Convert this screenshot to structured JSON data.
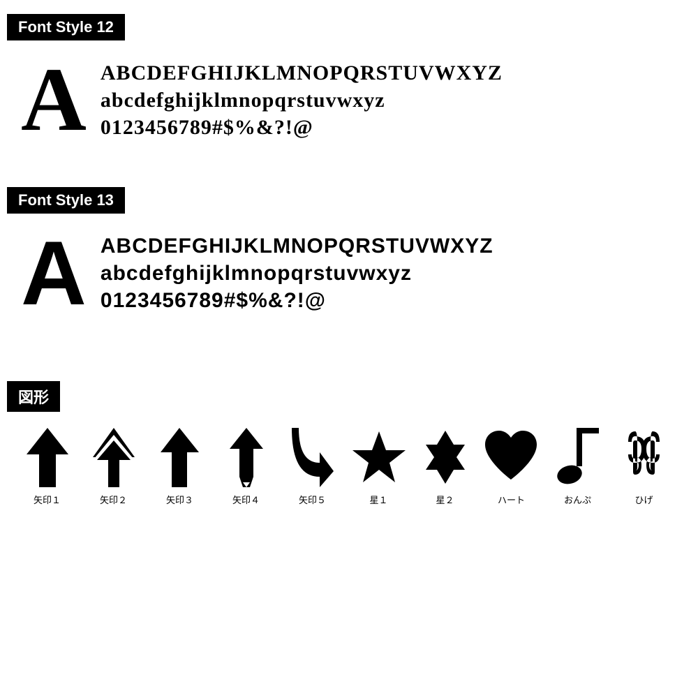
{
  "sections": {
    "font12": {
      "badge": "Font Style 12",
      "bigLetter": "A",
      "lines": [
        "ABCDEFGHIJKLMNOPQRSTUVWXYZ",
        "abcdefghijklmnopqrstuvwxyz",
        "0123456789#$%&?!@"
      ]
    },
    "font13": {
      "badge": "Font Style 13",
      "bigLetter": "A",
      "lines": [
        "ABCDEFGHIJKLMNOPQRSTUVWXYZ",
        "abcdefghijklmnopqrstuvwxyz",
        "0123456789#$%&?!@"
      ]
    },
    "shapes": {
      "badge": "図形",
      "items": [
        {
          "label": "矢印１",
          "type": "arrow1"
        },
        {
          "label": "矢印２",
          "type": "arrow2"
        },
        {
          "label": "矢印３",
          "type": "arrow3"
        },
        {
          "label": "矢印４",
          "type": "arrow4"
        },
        {
          "label": "矢印５",
          "type": "arrow5"
        },
        {
          "label": "星１",
          "type": "star1"
        },
        {
          "label": "星２",
          "type": "star2"
        },
        {
          "label": "ハート",
          "type": "heart"
        },
        {
          "label": "おんぷ",
          "type": "note"
        },
        {
          "label": "ひげ",
          "type": "mustache"
        }
      ]
    }
  }
}
